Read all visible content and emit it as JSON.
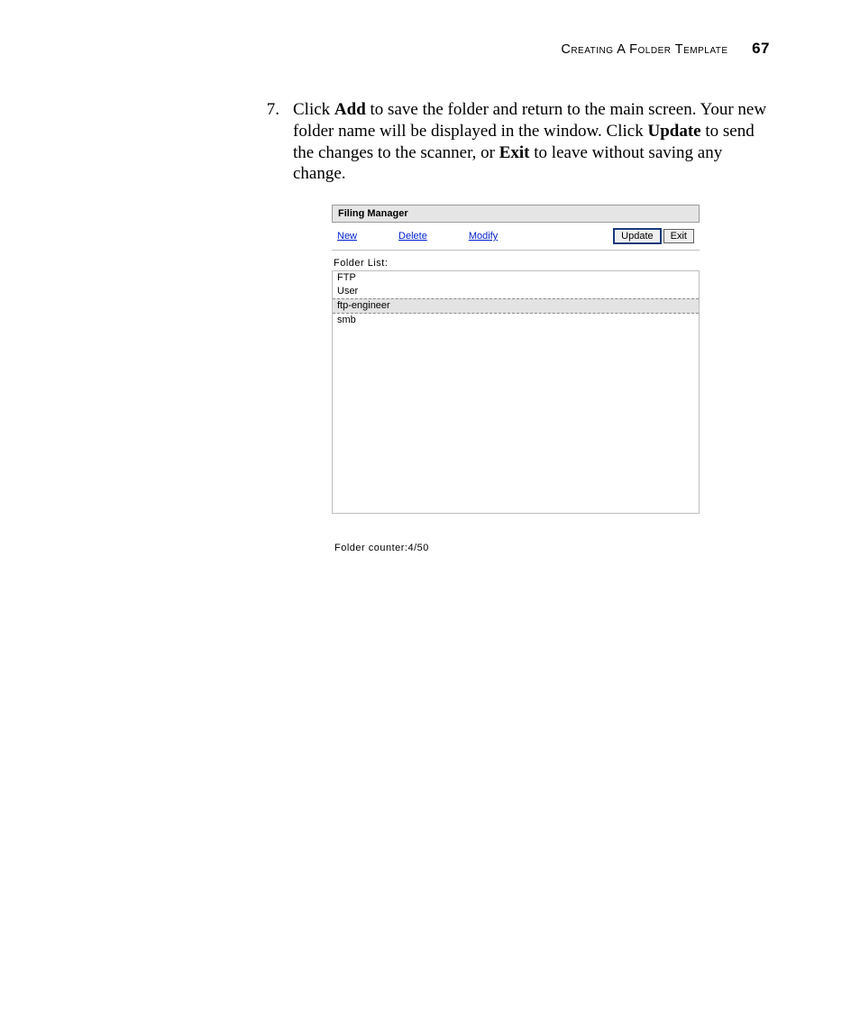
{
  "header": {
    "title": "Creating A Folder Template",
    "page_number": "67"
  },
  "step": {
    "number": "7.",
    "pre": "Click ",
    "b1": "Add",
    "mid1": " to save the folder and return to the main screen. Your new folder name will be displayed in the window. Click ",
    "b2": "Update",
    "mid2": " to send the changes to the scanner, or ",
    "b3": "Exit",
    "post": " to leave without saving any change."
  },
  "app": {
    "title": "Filing Manager",
    "toolbar": {
      "new": "New",
      "delete": "Delete",
      "modify": "Modify",
      "update": "Update",
      "exit": "Exit"
    },
    "list_label": "Folder List:",
    "folders": [
      {
        "name": "FTP",
        "selected": false
      },
      {
        "name": "User",
        "selected": false
      },
      {
        "name": "ftp-engineer",
        "selected": true
      },
      {
        "name": "smb",
        "selected": false
      }
    ],
    "counter": "Folder counter:4/50"
  }
}
